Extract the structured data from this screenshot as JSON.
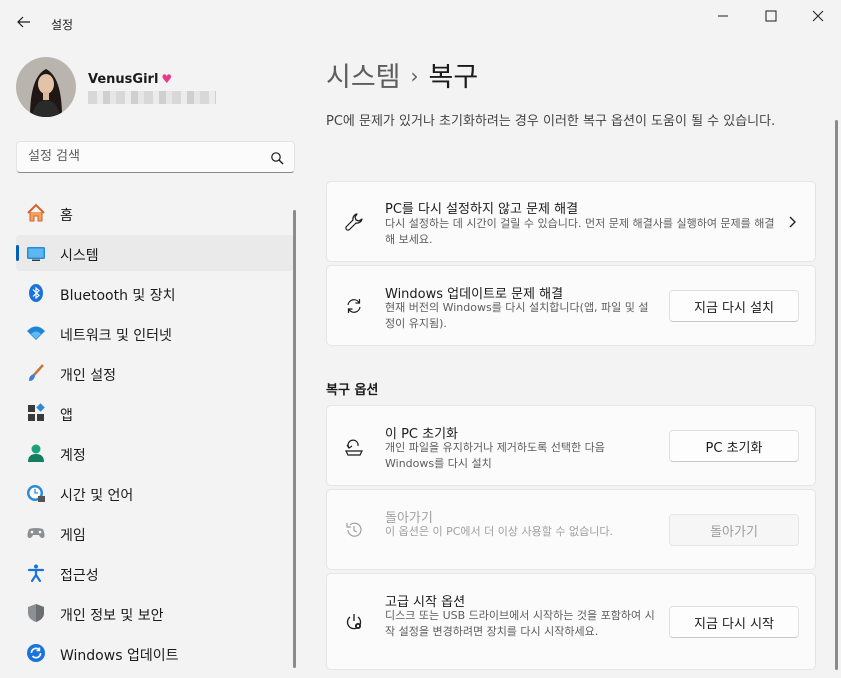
{
  "window": {
    "title": "설정"
  },
  "profile": {
    "name": "VenusGirl"
  },
  "search": {
    "placeholder": "설정 검색"
  },
  "nav": [
    {
      "label": "홈",
      "icon": "home-icon"
    },
    {
      "label": "시스템",
      "icon": "system-icon",
      "selected": true
    },
    {
      "label": "Bluetooth 및 장치",
      "icon": "bluetooth-icon"
    },
    {
      "label": "네트워크 및 인터넷",
      "icon": "network-icon"
    },
    {
      "label": "개인 설정",
      "icon": "personalization-icon"
    },
    {
      "label": "앱",
      "icon": "apps-icon"
    },
    {
      "label": "계정",
      "icon": "accounts-icon"
    },
    {
      "label": "시간 및 언어",
      "icon": "time-language-icon"
    },
    {
      "label": "게임",
      "icon": "gaming-icon"
    },
    {
      "label": "접근성",
      "icon": "accessibility-icon"
    },
    {
      "label": "개인 정보 및 보안",
      "icon": "privacy-shield-icon"
    },
    {
      "label": "Windows 업데이트",
      "icon": "windows-update-icon"
    }
  ],
  "page": {
    "breadcrumb_parent": "시스템",
    "breadcrumb_sep": "›",
    "title": "복구",
    "description": "PC에 문제가 있거나 초기화하려는 경우 이러한 복구 옵션이 도움이 될 수 있습니다."
  },
  "cards": {
    "troubleshoot": {
      "title": "PC를 다시 설정하지 않고 문제 해결",
      "desc": "다시 설정하는 데 시간이 걸릴 수 있습니다. 먼저 문제 해결사를 실행하여 문제를 해결해 보세요."
    },
    "winupdate": {
      "title": "Windows 업데이트로 문제 해결",
      "desc": "현재 버전의 Windows를 다시 설치합니다(앱, 파일 및 설정이 유지됨).",
      "button": "지금 다시 설치"
    },
    "section_title": "복구 옵션",
    "reset": {
      "title": "이 PC 초기화",
      "desc": "개인 파일을 유지하거나 제거하도록 선택한 다음 Windows를 다시 설치",
      "button": "PC 초기화"
    },
    "goback": {
      "title": "돌아가기",
      "desc": "이 옵션은 이 PC에서 더 이상 사용할 수 없습니다.",
      "button": "돌아가기",
      "disabled": true
    },
    "advanced": {
      "title": "고급 시작 옵션",
      "desc": "디스크 또는 USB 드라이브에서 시작하는 것을 포함하여 시작 설정을 변경하려면 장치를 다시 시작하세요.",
      "button": "지금 다시 시작"
    }
  },
  "colors": {
    "accent": "#005fb8",
    "background": "#f3f3f3",
    "card": "#fbfbfb"
  }
}
